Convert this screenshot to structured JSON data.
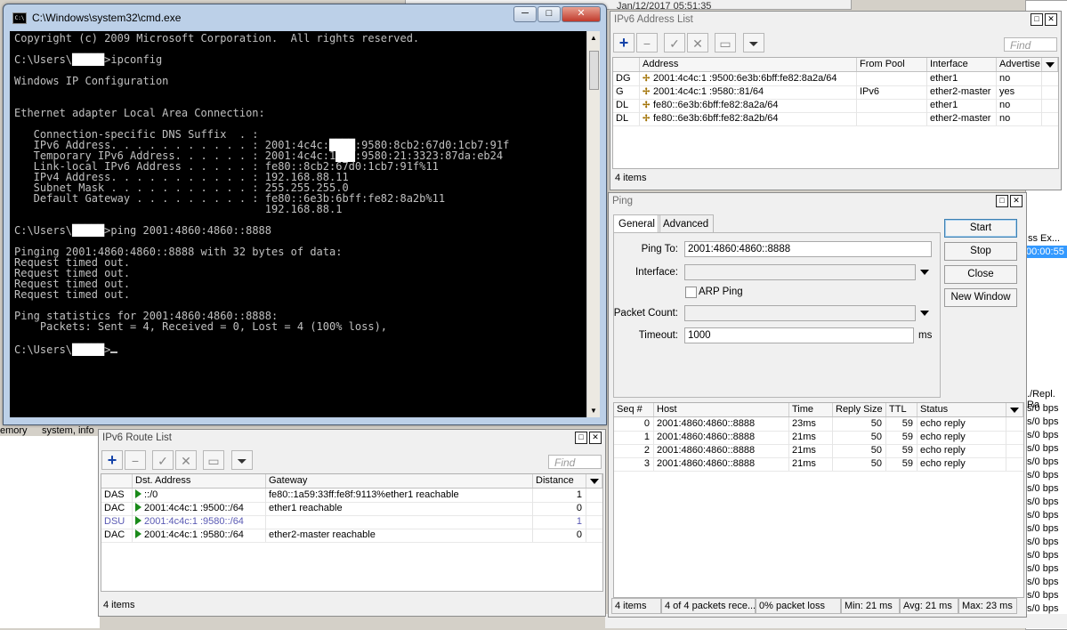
{
  "background": {
    "log_timestamp": "Jan/12/2017 05:51:35",
    "bg_label_memory": "emory",
    "bg_label_system": "system, info",
    "bg_column_header": "ss Ex...",
    "bg_selected_value": "00:00:55",
    "bg_column_header_2": "./Repl. Ra",
    "bg_rate_values": [
      "s/0 bps",
      "s/0 bps",
      "s/0 bps",
      "s/0 bps",
      "s/0 bps",
      "s/0 bps",
      "s/0 bps",
      "s/0 bps",
      "s/0 bps",
      "s/0 bps",
      "s/0 bps",
      "s/0 bps",
      "s/0 bps",
      "s/0 bps",
      "s/0 bps",
      "s/0 bps"
    ]
  },
  "cmd": {
    "title": "C:\\Windows\\system32\\cmd.exe",
    "icon": "console-icon",
    "btn_min": "─",
    "btn_max": "□",
    "btn_close": "✕",
    "lines": [
      {
        "text": "Copyright (c) 2009 Microsoft Corporation.  All rights reserved."
      },
      {
        "text": ""
      },
      {
        "pre": "C:\\Users\\",
        "redacted": "█████",
        "post": ">ipconfig"
      },
      {
        "text": ""
      },
      {
        "text": "Windows IP Configuration"
      },
      {
        "text": ""
      },
      {
        "text": ""
      },
      {
        "text": "Ethernet adapter Local Area Connection:"
      },
      {
        "text": ""
      },
      {
        "text": "   Connection-specific DNS Suffix  . :"
      },
      {
        "pre": "   IPv6 Address. . . . . . . . . . . : 2001:4c4c:",
        "redacted": "████",
        "post": ":9580:8cb2:67d0:1cb7:91f"
      },
      {
        "pre": "   Temporary IPv6 Address. . . . . . : 2001:4c4c:1",
        "redacted": "███",
        "post": ":9580:21:3323:87da:eb24"
      },
      {
        "text": "   Link-local IPv6 Address . . . . . : fe80::8cb2:67d0:1cb7:91f%11"
      },
      {
        "text": "   IPv4 Address. . . . . . . . . . . : 192.168.88.11"
      },
      {
        "text": "   Subnet Mask . . . . . . . . . . . : 255.255.255.0"
      },
      {
        "text": "   Default Gateway . . . . . . . . . : fe80::6e3b:6bff:fe82:8a2b%11"
      },
      {
        "text": "                                       192.168.88.1"
      },
      {
        "text": ""
      },
      {
        "pre": "C:\\Users\\",
        "redacted": "█████",
        "post": ">ping 2001:4860:4860::8888"
      },
      {
        "text": ""
      },
      {
        "text": "Pinging 2001:4860:4860::8888 with 32 bytes of data:"
      },
      {
        "text": "Request timed out."
      },
      {
        "text": "Request timed out."
      },
      {
        "text": "Request timed out."
      },
      {
        "text": "Request timed out."
      },
      {
        "text": ""
      },
      {
        "text": "Ping statistics for 2001:4860:4860::8888:"
      },
      {
        "text": "    Packets: Sent = 4, Received = 0, Lost = 4 (100% loss),"
      },
      {
        "text": ""
      },
      {
        "pre": "C:\\Users\\",
        "redacted": "█████",
        "post": ">",
        "cursor": true
      }
    ]
  },
  "ipv6_address_list": {
    "title": "IPv6 Address List",
    "find_placeholder": "Find",
    "columns": [
      "Address",
      "From Pool",
      "Interface",
      "Advertise"
    ],
    "rows": [
      {
        "flags": "DG",
        "address": "2001:4c4c:1  :9500:6e3b:6bff:fe82:8a2a/64",
        "pool": "",
        "interface": "ether1",
        "advertise": "no"
      },
      {
        "flags": "G",
        "address": "2001:4c4c:1  :9580::81/64",
        "pool": "IPv6",
        "interface": "ether2-master",
        "advertise": "yes"
      },
      {
        "flags": "DL",
        "address": "fe80::6e3b:6bff:fe82:8a2a/64",
        "pool": "",
        "interface": "ether1",
        "advertise": "no"
      },
      {
        "flags": "DL",
        "address": "fe80::6e3b:6bff:fe82:8a2b/64",
        "pool": "",
        "interface": "ether2-master",
        "advertise": "no"
      }
    ],
    "status": "4 items"
  },
  "ipv6_route_list": {
    "title": "IPv6 Route List",
    "find_placeholder": "Find",
    "columns": [
      "Dst. Address",
      "Gateway",
      "Distance"
    ],
    "rows": [
      {
        "flags": "DAS",
        "dst": "::/0",
        "gateway": "fe80::1a59:33ff:fe8f:9113%ether1 reachable",
        "distance": "1",
        "style": ""
      },
      {
        "flags": "DAC",
        "dst": "2001:4c4c:1  :9500::/64",
        "gateway": "ether1 reachable",
        "distance": "0",
        "style": ""
      },
      {
        "flags": "DSU",
        "dst": "2001:4c4c:1  :9580::/64",
        "gateway": "",
        "distance": "1",
        "style": "dsu"
      },
      {
        "flags": "DAC",
        "dst": "2001:4c4c:1  :9580::/64",
        "gateway": "ether2-master reachable",
        "distance": "0",
        "style": ""
      }
    ],
    "status": "4 items"
  },
  "ping": {
    "title": "Ping",
    "tabs": [
      "General",
      "Advanced"
    ],
    "labels": {
      "ping_to": "Ping To:",
      "interface": "Interface:",
      "arp_ping": "ARP Ping",
      "packet_count": "Packet Count:",
      "timeout": "Timeout:",
      "timeout_unit": "ms"
    },
    "values": {
      "ping_to": "2001:4860:4860::8888",
      "interface": "",
      "packet_count": "",
      "timeout": "1000"
    },
    "buttons": [
      "Start",
      "Stop",
      "Close",
      "New Window"
    ],
    "columns": [
      "Seq #",
      "Host",
      "Time",
      "Reply Size",
      "TTL",
      "Status"
    ],
    "rows": [
      {
        "seq": "0",
        "host": "2001:4860:4860::8888",
        "time": "23ms",
        "size": "50",
        "ttl": "59",
        "status": "echo reply"
      },
      {
        "seq": "1",
        "host": "2001:4860:4860::8888",
        "time": "21ms",
        "size": "50",
        "ttl": "59",
        "status": "echo reply"
      },
      {
        "seq": "2",
        "host": "2001:4860:4860::8888",
        "time": "21ms",
        "size": "50",
        "ttl": "59",
        "status": "echo reply"
      },
      {
        "seq": "3",
        "host": "2001:4860:4860::8888",
        "time": "21ms",
        "size": "50",
        "ttl": "59",
        "status": "echo reply"
      }
    ],
    "status_bar": [
      "4 items",
      "4 of 4 packets rece...",
      "0% packet loss",
      "Min: 21 ms",
      "Avg: 21 ms",
      "Max: 23 ms"
    ]
  }
}
